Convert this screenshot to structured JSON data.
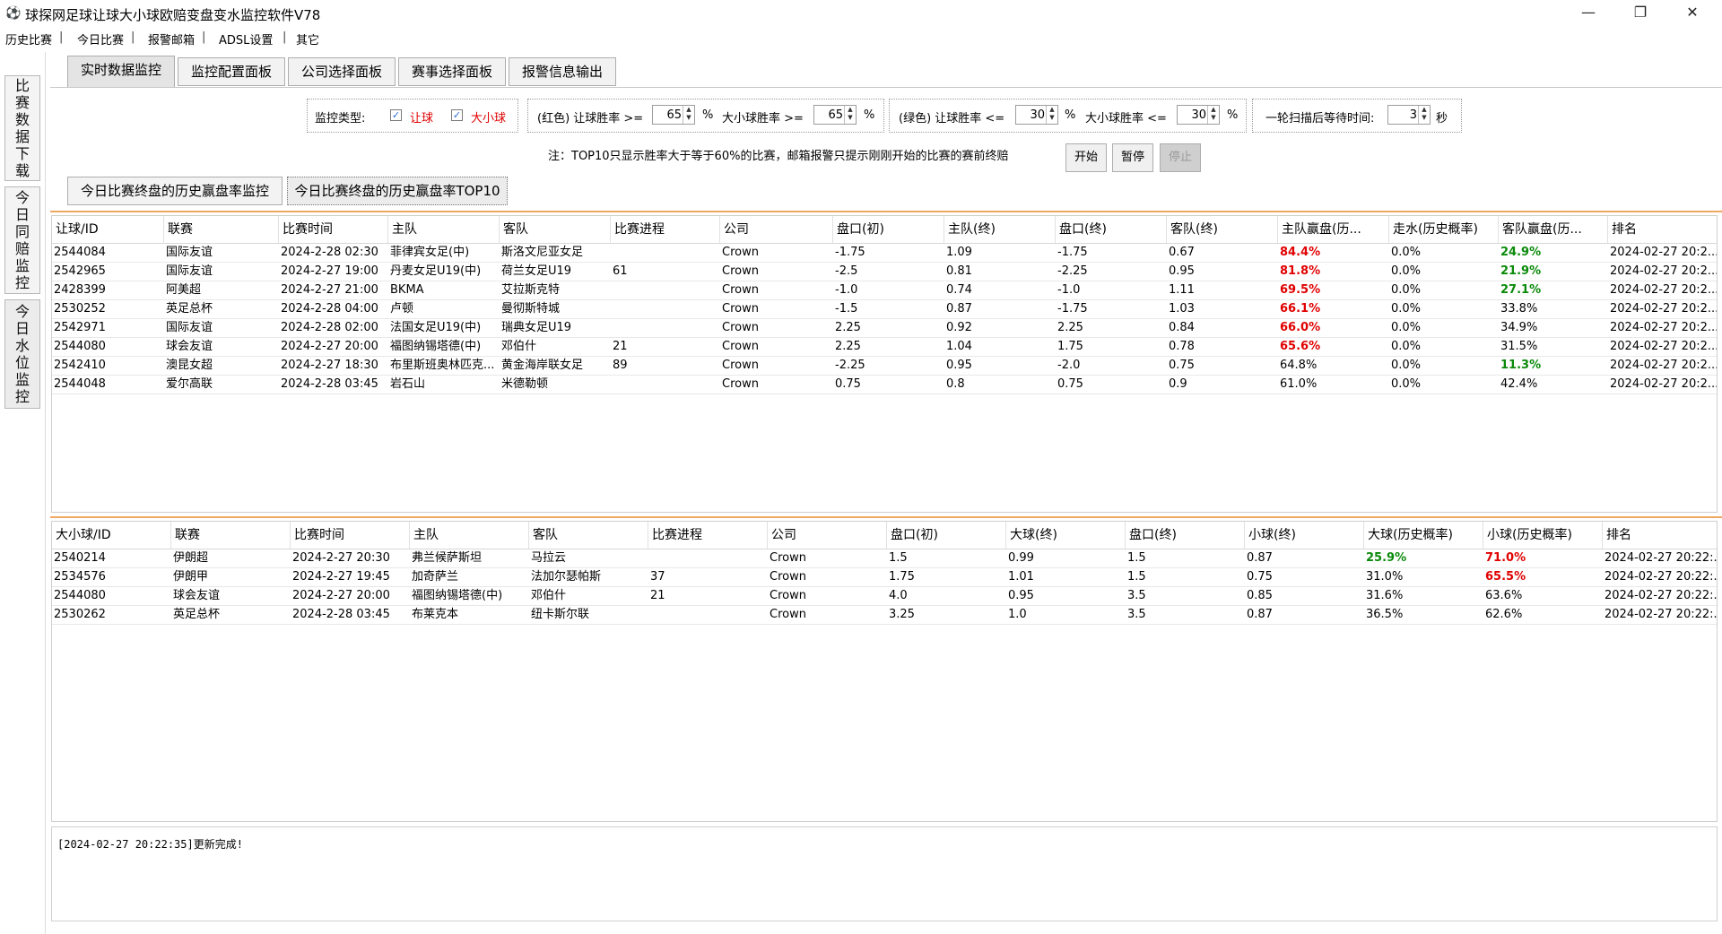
{
  "window": {
    "title": "球探网足球让球大小球欧赔变盘变水监控软件V78",
    "minimize": "—",
    "restore": "❐",
    "close": "✕",
    "icon": "football-icon"
  },
  "menu": [
    "历史比赛",
    "今日比赛",
    "报警邮箱",
    "ADSL设置",
    "其它"
  ],
  "menu_sep": "|",
  "side_tabs": [
    {
      "label": "比赛数据下载",
      "chars": [
        "比",
        "赛",
        "数",
        "据",
        "下",
        "载"
      ]
    },
    {
      "label": "今日同赔监控",
      "chars": [
        "今",
        "日",
        "同",
        "赔",
        "监",
        "控"
      ]
    },
    {
      "label": "今日水位监控",
      "chars": [
        "今",
        "日",
        "水",
        "位",
        "监",
        "控"
      ]
    }
  ],
  "tabs": [
    "实时数据监控",
    "监控配置面板",
    "公司选择面板",
    "赛事选择面板",
    "报警信息输出"
  ],
  "config": {
    "monitor_type_label": "监控类型:",
    "opt_handicap": "让球",
    "opt_overunder": "大小球",
    "red_group": {
      "handicap_label": "(红色) 让球胜率 >=",
      "handicap_value": "65",
      "pct1": "%",
      "ou_label": "大小球胜率 >=",
      "ou_value": "65",
      "pct2": "%"
    },
    "green_group": {
      "handicap_label": "(绿色) 让球胜率 <=",
      "handicap_value": "30",
      "pct1": "%",
      "ou_label": "大小球胜率 <=",
      "ou_value": "30",
      "pct2": "%"
    },
    "wait_group": {
      "label": "一轮扫描后等待时间:",
      "value": "3",
      "unit": "秒"
    },
    "check_mark": "✓",
    "spin_up": "▲",
    "spin_down": "▼"
  },
  "note": "注：TOP10只显示胜率大于等于60%的比赛，邮箱报警只提示刚刚开始的比赛的赛前终赔",
  "buttons": {
    "start": "开始",
    "pause": "暂停",
    "stop": "停止"
  },
  "sub_tabs": [
    "今日比赛终盘的历史赢盘率监控",
    "今日比赛终盘的历史赢盘率TOP10"
  ],
  "handicap_table": {
    "headers": [
      "让球/ID",
      "联赛",
      "比赛时间",
      "主队",
      "客队",
      "比赛进程",
      "公司",
      "盘口(初)",
      "主队(终)",
      "盘口(终)",
      "客队(终)",
      "主队赢盘(历...",
      "走水(历史概率)",
      "客队赢盘(历...",
      "排名"
    ],
    "rows": [
      [
        "2544084",
        "国际友谊",
        "2024-2-28 02:30",
        "菲律宾女足(中)",
        "斯洛文尼亚女足",
        "",
        "Crown",
        "-1.75",
        "1.09",
        "-1.75",
        "0.67",
        "84.4%",
        "0.0%",
        "24.9%",
        "2024-02-27 20:2..."
      ],
      [
        "2542965",
        "国际友谊",
        "2024-2-27 19:00",
        "丹麦女足U19(中)",
        "荷兰女足U19",
        "61",
        "Crown",
        "-2.5",
        "0.81",
        "-2.25",
        "0.95",
        "81.8%",
        "0.0%",
        "21.9%",
        "2024-02-27 20:2..."
      ],
      [
        "2428399",
        "阿美超",
        "2024-2-27 21:00",
        "BKMA",
        "艾拉斯克特",
        "",
        "Crown",
        "-1.0",
        "0.74",
        "-1.0",
        "1.11",
        "69.5%",
        "0.0%",
        "27.1%",
        "2024-02-27 20:2..."
      ],
      [
        "2530252",
        "英足总杯",
        "2024-2-28 04:00",
        "卢顿",
        "曼彻斯特城",
        "",
        "Crown",
        "-1.5",
        "0.87",
        "-1.75",
        "1.03",
        "66.1%",
        "0.0%",
        "33.8%",
        "2024-02-27 20:2..."
      ],
      [
        "2542971",
        "国际友谊",
        "2024-2-28 02:00",
        "法国女足U19(中)",
        "瑞典女足U19",
        "",
        "Crown",
        "2.25",
        "0.92",
        "2.25",
        "0.84",
        "66.0%",
        "0.0%",
        "34.9%",
        "2024-02-27 20:2..."
      ],
      [
        "2544080",
        "球会友谊",
        "2024-2-27 20:00",
        "福图纳锡塔德(中)",
        "邓伯什",
        "21",
        "Crown",
        "2.25",
        "1.04",
        "1.75",
        "0.78",
        "65.6%",
        "0.0%",
        "31.5%",
        "2024-02-27 20:2..."
      ],
      [
        "2542410",
        "澳昆女超",
        "2024-2-27 18:30",
        "布里斯班奥林匹克...",
        "黄金海岸联女足",
        "89",
        "Crown",
        "-2.25",
        "0.95",
        "-2.0",
        "0.75",
        "64.8%",
        "0.0%",
        "11.3%",
        "2024-02-27 20:2..."
      ],
      [
        "2544048",
        "爱尔高联",
        "2024-2-28 03:45",
        "岩石山",
        "米德勒顿",
        "",
        "Crown",
        "0.75",
        "0.8",
        "0.75",
        "0.9",
        "61.0%",
        "0.0%",
        "42.4%",
        "2024-02-27 20:2..."
      ]
    ],
    "row_styles": [
      {
        "home": "red",
        "away": "green"
      },
      {
        "home": "red",
        "away": "green"
      },
      {
        "home": "red",
        "away": "green"
      },
      {
        "home": "red",
        "away": ""
      },
      {
        "home": "red",
        "away": ""
      },
      {
        "home": "red",
        "away": ""
      },
      {
        "home": "",
        "away": "green"
      },
      {
        "home": "",
        "away": ""
      }
    ]
  },
  "ou_table": {
    "headers": [
      "大小球/ID",
      "联赛",
      "比赛时间",
      "主队",
      "客队",
      "比赛进程",
      "公司",
      "盘口(初)",
      "大球(终)",
      "盘口(终)",
      "小球(终)",
      "大球(历史概率)",
      "小球(历史概率)",
      "排名"
    ],
    "rows": [
      [
        "2540214",
        "伊朗超",
        "2024-2-27 20:30",
        "弗兰候萨斯坦",
        "马拉云",
        "",
        "Crown",
        "1.5",
        "0.99",
        "1.5",
        "0.87",
        "25.9%",
        "71.0%",
        "2024-02-27 20:22:..."
      ],
      [
        "2534576",
        "伊朗甲",
        "2024-2-27 19:45",
        "加奇萨兰",
        "法加尔瑟帕斯",
        "37",
        "Crown",
        "1.75",
        "1.01",
        "1.5",
        "0.75",
        "31.0%",
        "65.5%",
        "2024-02-27 20:22:..."
      ],
      [
        "2544080",
        "球会友谊",
        "2024-2-27 20:00",
        "福图纳锡塔德(中)",
        "邓伯什",
        "21",
        "Crown",
        "4.0",
        "0.95",
        "3.5",
        "0.85",
        "31.6%",
        "63.6%",
        "2024-02-27 20:22:..."
      ],
      [
        "2530262",
        "英足总杯",
        "2024-2-28 03:45",
        "布莱克本",
        "纽卡斯尔联",
        "",
        "Crown",
        "3.25",
        "1.0",
        "3.5",
        "0.87",
        "36.5%",
        "62.6%",
        "2024-02-27 20:22:..."
      ]
    ],
    "row_styles": [
      {
        "over": "green",
        "under": "red"
      },
      {
        "over": "",
        "under": "red"
      },
      {
        "over": "",
        "under": ""
      },
      {
        "over": "",
        "under": ""
      }
    ]
  },
  "log": "[2024-02-27 20:22:35]更新完成!",
  "colors": {
    "red": "#e00000",
    "green": "#0a8a0a",
    "accent_line": "#f0a860"
  }
}
